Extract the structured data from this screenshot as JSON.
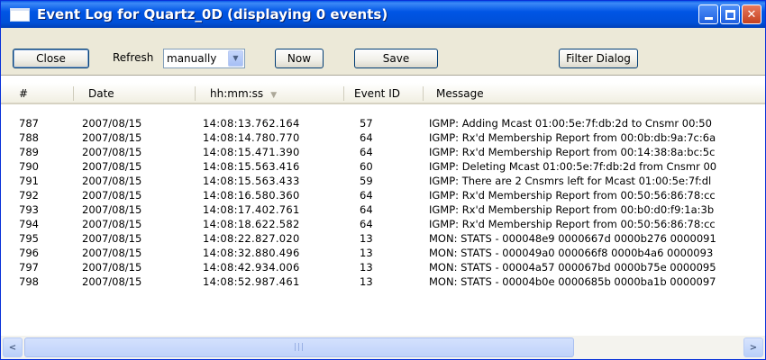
{
  "window": {
    "title": "Event Log for Quartz_0D (displaying 0 events)"
  },
  "toolbar": {
    "close_label": "Close",
    "refresh_label": "Refresh",
    "refresh_value": "manually",
    "now_label": "Now",
    "save_label": "Save",
    "filter_label": "Filter Dialog"
  },
  "columns": {
    "num": "#",
    "date": "Date",
    "time": "hh:mm:ss",
    "event_id": "Event ID",
    "message": "Message"
  },
  "rows": [
    {
      "num": "787",
      "date": "2007/08/15",
      "time": "14:08:13.762.164",
      "event_id": "57",
      "message": "IGMP: Adding Mcast 01:00:5e:7f:db:2d to Cnsmr 00:50"
    },
    {
      "num": "788",
      "date": "2007/08/15",
      "time": "14:08:14.780.770",
      "event_id": "64",
      "message": "IGMP: Rx'd Membership Report from 00:0b:db:9a:7c:6a"
    },
    {
      "num": "789",
      "date": "2007/08/15",
      "time": "14:08:15.471.390",
      "event_id": "64",
      "message": "IGMP: Rx'd Membership Report from 00:14:38:8a:bc:5c"
    },
    {
      "num": "790",
      "date": "2007/08/15",
      "time": "14:08:15.563.416",
      "event_id": "60",
      "message": "IGMP: Deleting Mcast 01:00:5e:7f:db:2d from Cnsmr 00"
    },
    {
      "num": "791",
      "date": "2007/08/15",
      "time": "14:08:15.563.433",
      "event_id": "59",
      "message": "IGMP: There are 2 Cnsmrs left for Mcast 01:00:5e:7f:dl"
    },
    {
      "num": "792",
      "date": "2007/08/15",
      "time": "14:08:16.580.360",
      "event_id": "64",
      "message": "IGMP: Rx'd Membership Report from 00:50:56:86:78:cc"
    },
    {
      "num": "793",
      "date": "2007/08/15",
      "time": "14:08:17.402.761",
      "event_id": "64",
      "message": "IGMP: Rx'd Membership Report from 00:b0:d0:f9:1a:3b"
    },
    {
      "num": "794",
      "date": "2007/08/15",
      "time": "14:08:18.622.582",
      "event_id": "64",
      "message": "IGMP: Rx'd Membership Report from 00:50:56:86:78:cc"
    },
    {
      "num": "795",
      "date": "2007/08/15",
      "time": "14:08:22.827.020",
      "event_id": "13",
      "message": "MON: STATS - 000048e9 0000667d 0000b276 0000091"
    },
    {
      "num": "796",
      "date": "2007/08/15",
      "time": "14:08:32.880.496",
      "event_id": "13",
      "message": "MON: STATS - 000049a0 000066f8 0000b4a6 0000093"
    },
    {
      "num": "797",
      "date": "2007/08/15",
      "time": "14:08:42.934.006",
      "event_id": "13",
      "message": "MON: STATS - 00004a57 000067bd 0000b75e 0000095"
    },
    {
      "num": "798",
      "date": "2007/08/15",
      "time": "14:08:52.987.461",
      "event_id": "13",
      "message": "MON: STATS - 00004b0e 0000685b 0000ba1b 0000097"
    }
  ],
  "icons": {
    "window": "window-icon",
    "minimize": "minimize-icon",
    "maximize": "maximize-icon",
    "close": "close-icon",
    "dropdown": "chevron-down-icon",
    "sort": "sort-desc-icon",
    "scroll_left": "chevron-left-icon",
    "scroll_right": "chevron-right-icon"
  },
  "colors": {
    "titlebar": "#0055e5",
    "window_bg": "#ece9d8",
    "list_bg": "#ffffff"
  }
}
